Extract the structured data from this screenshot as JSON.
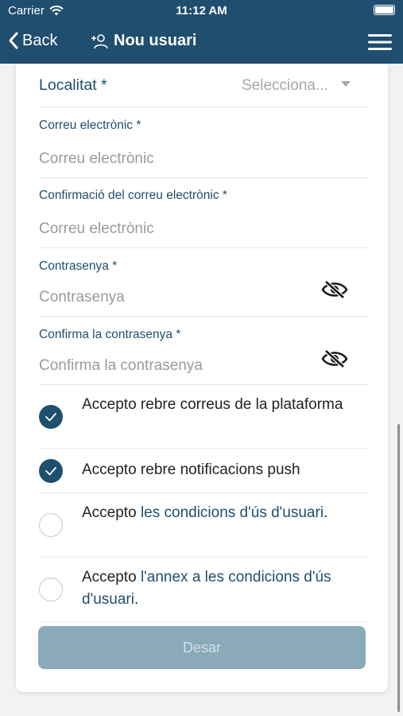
{
  "status_bar": {
    "carrier": "Carrier",
    "time": "11:12 AM"
  },
  "nav": {
    "back_label": "Back",
    "title": "Nou usuari"
  },
  "form": {
    "localitat": {
      "label": "Localitat *",
      "placeholder": "Selecciona..."
    },
    "email": {
      "label": "Correu electrònic *",
      "placeholder": "Correu electrònic"
    },
    "email_confirm": {
      "label": "Confirmació del correu electrònic *",
      "placeholder": "Correu electrònic"
    },
    "password": {
      "label": "Contrasenya *",
      "placeholder": "Contrasenya"
    },
    "password_confirm": {
      "label": "Confirma la contrasenya *",
      "placeholder": "Confirma la contrasenya"
    }
  },
  "checkboxes": [
    {
      "text": "Accepto rebre correus de la plataforma",
      "checked": true
    },
    {
      "text": "Accepto rebre notificacions push",
      "checked": true
    },
    {
      "prefix": "Accepto ",
      "link": "les condicions d'ús d'usuari",
      "suffix": ".",
      "checked": false
    },
    {
      "prefix": "Accepto ",
      "link": "l'annex a les condicions d'ús d'usuari",
      "suffix": ".",
      "checked": false
    }
  ],
  "save_button": {
    "label": "Desar",
    "enabled": false
  },
  "colors": {
    "primary": "#1f4e6e",
    "disabled_button": "#8aa9b9",
    "placeholder": "#9a9a9a"
  }
}
